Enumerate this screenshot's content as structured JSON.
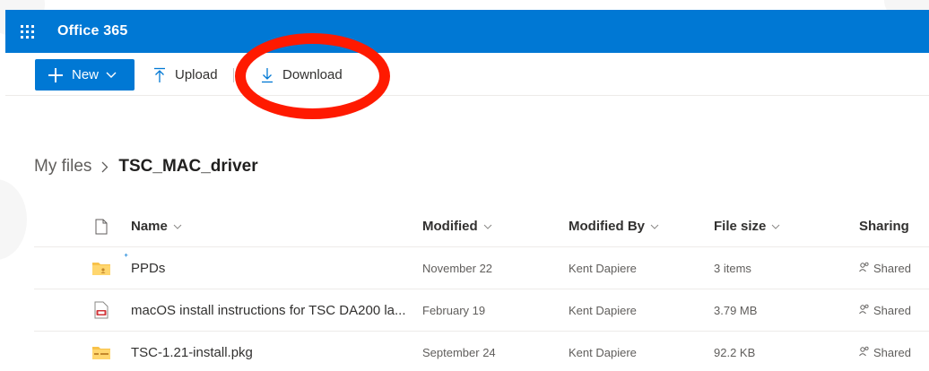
{
  "app": {
    "title": "Office 365"
  },
  "toolbar": {
    "new_label": "New",
    "upload_label": "Upload",
    "download_label": "Download"
  },
  "breadcrumb": {
    "root": "My files",
    "separator": ">",
    "current": "TSC_MAC_driver"
  },
  "columns": {
    "name": "Name",
    "modified": "Modified",
    "modified_by": "Modified By",
    "file_size": "File size",
    "sharing": "Sharing"
  },
  "files": [
    {
      "icon": "folder-shared-icon",
      "name": "PPDs",
      "modified": "November 22",
      "modified_by": "Kent Dapiere",
      "size": "3 items",
      "sharing": "Shared"
    },
    {
      "icon": "pdf-file-icon",
      "name": "macOS install instructions for TSC DA200 la...",
      "modified": "February 19",
      "modified_by": "Kent Dapiere",
      "size": "3.79 MB",
      "sharing": "Shared"
    },
    {
      "icon": "package-file-icon",
      "name": "TSC-1.21-install.pkg",
      "modified": "September 24",
      "modified_by": "Kent Dapiere",
      "size": "92.2 KB",
      "sharing": "Shared"
    }
  ],
  "colors": {
    "suite_bar": "#0078d4",
    "highlight_ring": "#ff1a00",
    "folder": "#f8c24a"
  }
}
